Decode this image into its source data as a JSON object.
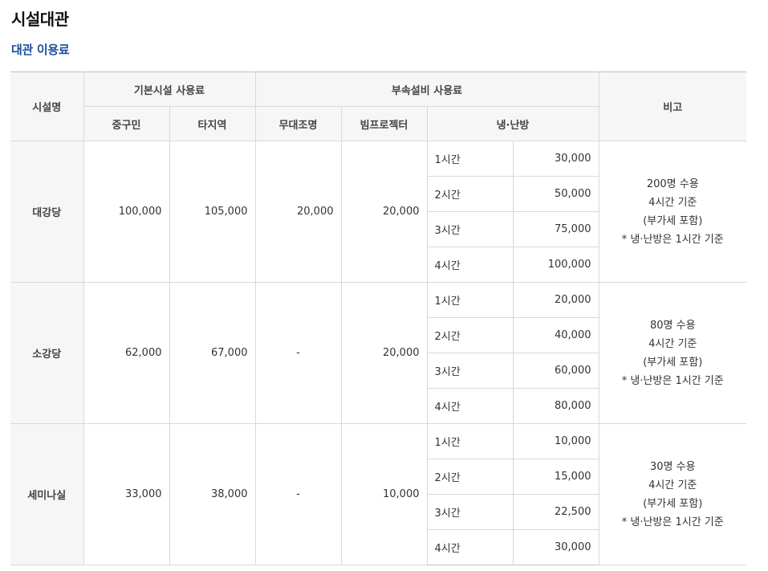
{
  "page": {
    "title": "시설대관",
    "subtitle": "대관 이용료"
  },
  "table": {
    "headers": {
      "facility": "시설명",
      "basic_fee": "기본시설 사용료",
      "residents": "중구민",
      "others": "타지역",
      "equipment_fee": "부속설비 사용료",
      "stage_lighting": "무대조명",
      "projector": "빔프로젝터",
      "hvac": "냉·난방",
      "remarks": "비고"
    },
    "rows": [
      {
        "name": "대강당",
        "residents": "100,000",
        "others": "105,000",
        "stage_lighting": "20,000",
        "projector": "20,000",
        "hvac": [
          {
            "hour": "1시간",
            "fee": "30,000"
          },
          {
            "hour": "2시간",
            "fee": "50,000"
          },
          {
            "hour": "3시간",
            "fee": "75,000"
          },
          {
            "hour": "4시간",
            "fee": "100,000"
          }
        ],
        "remarks": [
          "200명 수용",
          "4시간 기준",
          "(부가세 포함)",
          "* 냉·난방은 1시간 기준"
        ]
      },
      {
        "name": "소강당",
        "residents": "62,000",
        "others": "67,000",
        "stage_lighting": "-",
        "projector": "20,000",
        "hvac": [
          {
            "hour": "1시간",
            "fee": "20,000"
          },
          {
            "hour": "2시간",
            "fee": "40,000"
          },
          {
            "hour": "3시간",
            "fee": "60,000"
          },
          {
            "hour": "4시간",
            "fee": "80,000"
          }
        ],
        "remarks": [
          "80명 수용",
          "4시간 기준",
          "(부가세 포함)",
          "* 냉·난방은 1시간 기준"
        ]
      },
      {
        "name": "세미나실",
        "residents": "33,000",
        "others": "38,000",
        "stage_lighting": "-",
        "projector": "10,000",
        "hvac": [
          {
            "hour": "1시간",
            "fee": "10,000"
          },
          {
            "hour": "2시간",
            "fee": "15,000"
          },
          {
            "hour": "3시간",
            "fee": "22,500"
          },
          {
            "hour": "4시간",
            "fee": "30,000"
          }
        ],
        "remarks": [
          "30명 수용",
          "4시간 기준",
          "(부가세 포함)",
          "* 냉·난방은 1시간 기준"
        ]
      }
    ]
  }
}
